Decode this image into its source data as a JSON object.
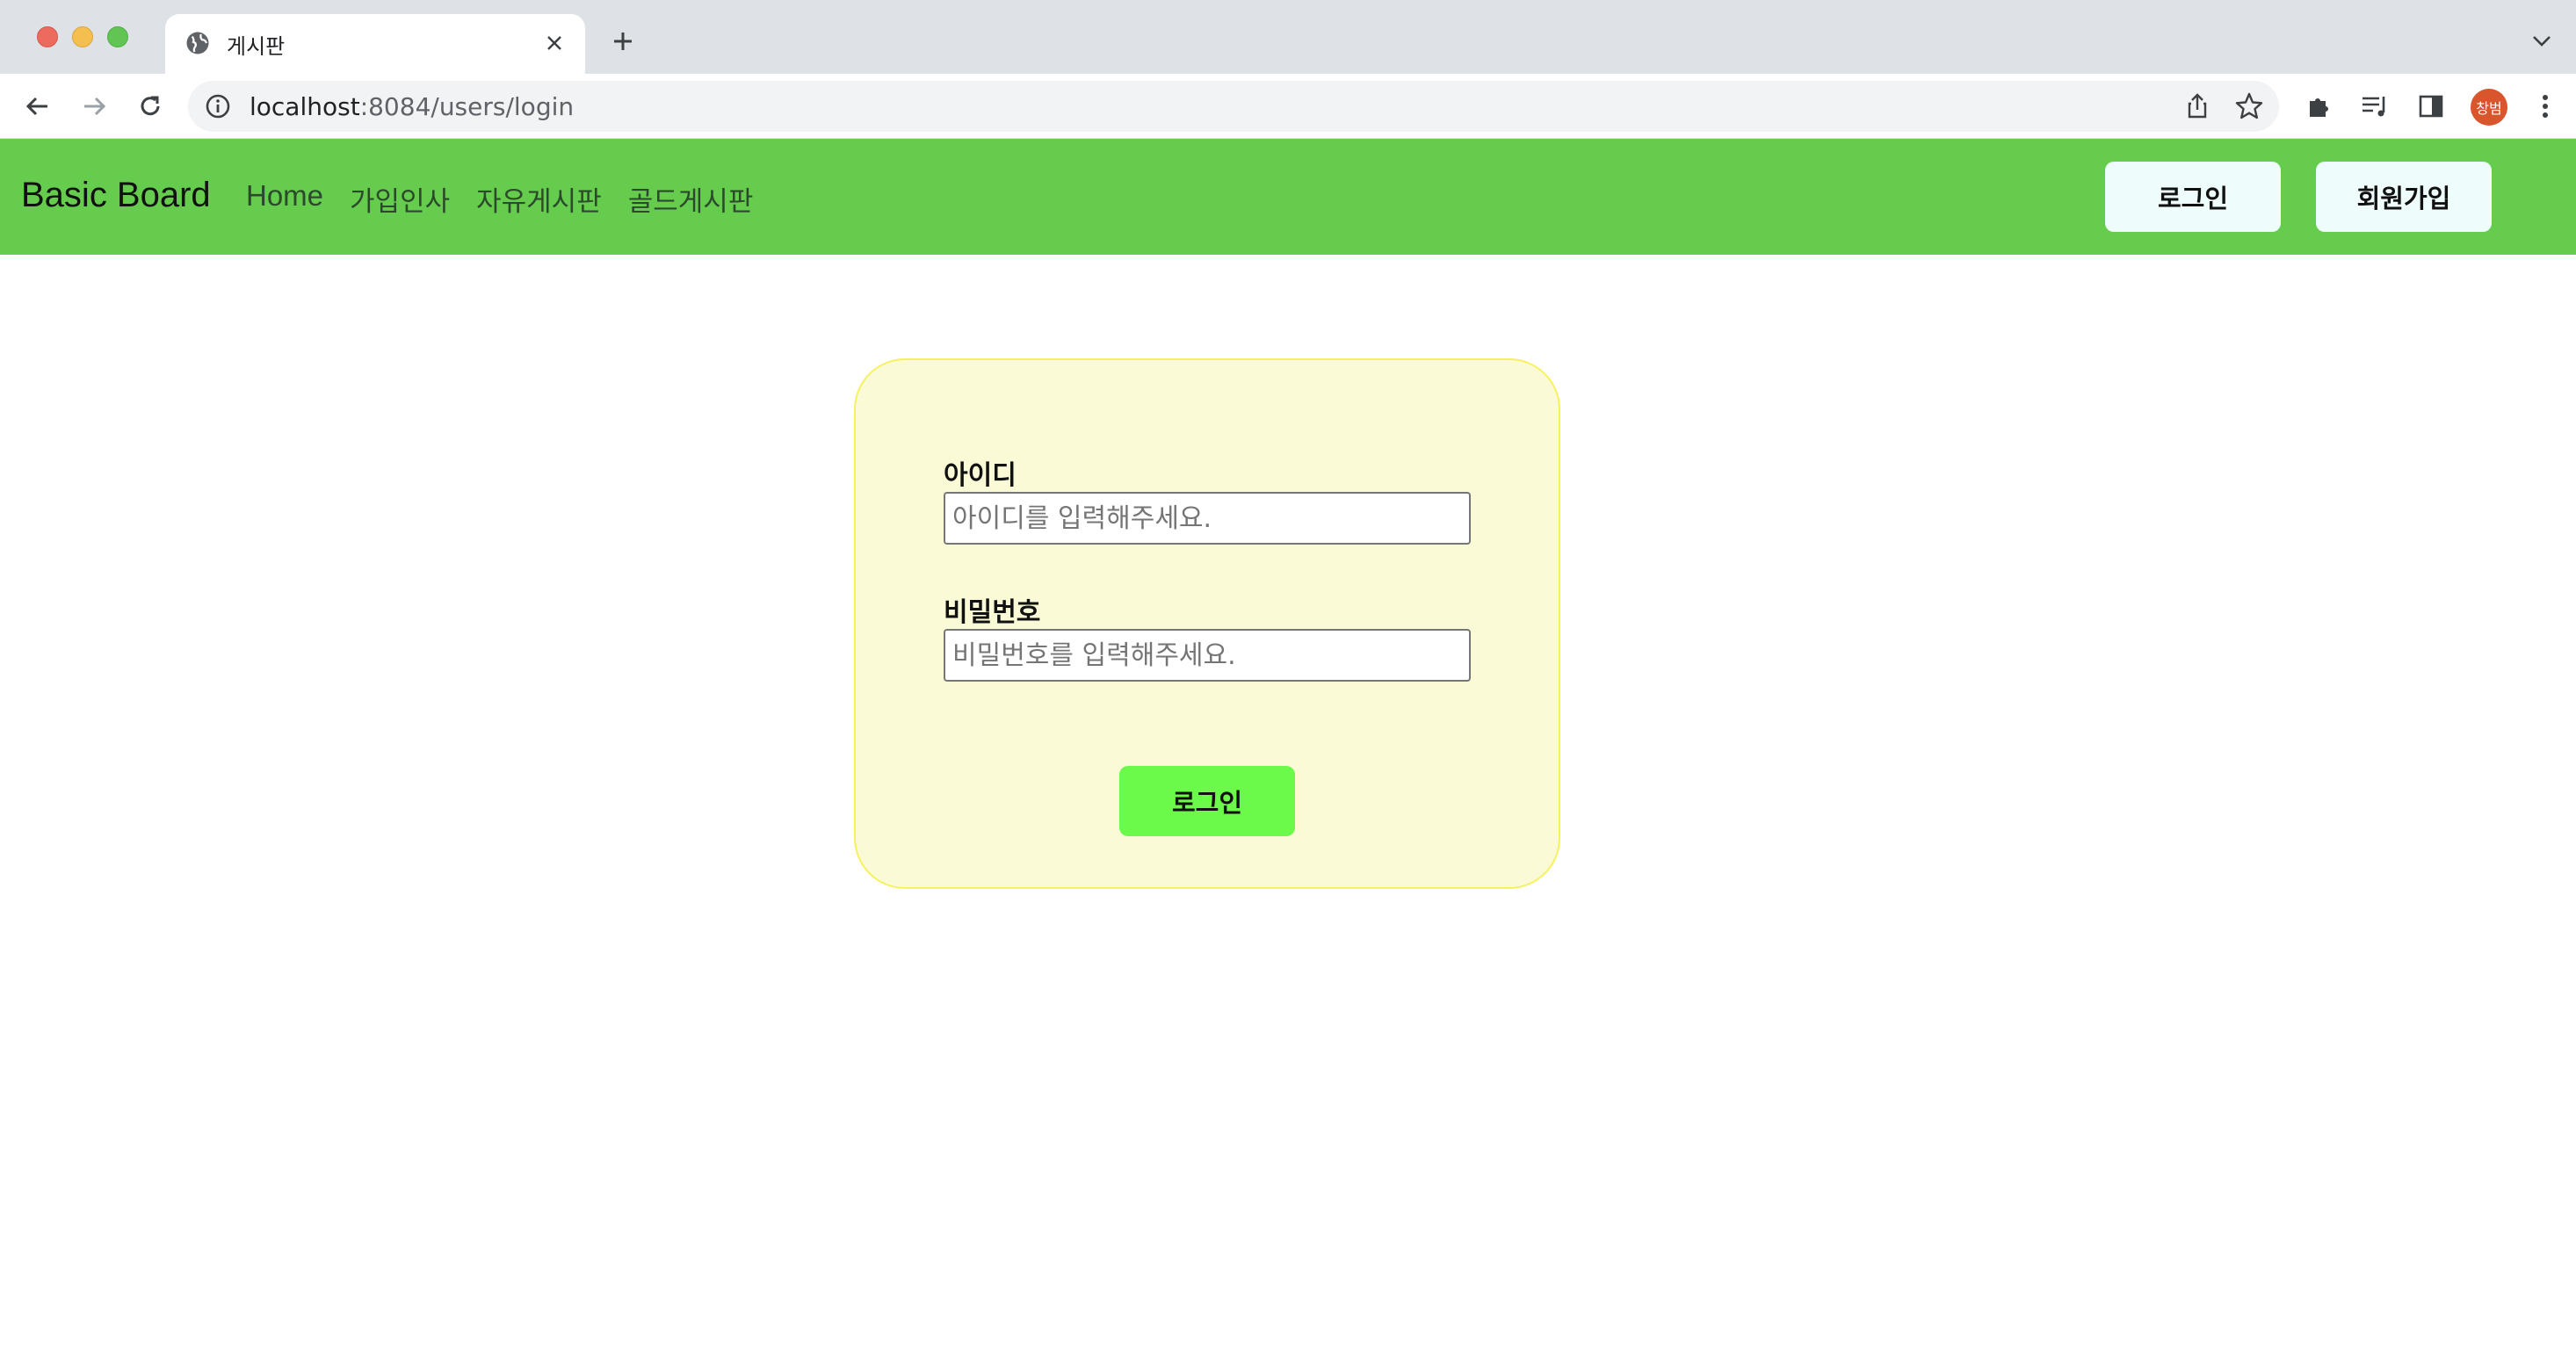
{
  "browser": {
    "tab_title": "게시판",
    "url_host": "localhost",
    "url_rest": ":8084/users/login",
    "profile_initials": "창범"
  },
  "navbar": {
    "brand": "Basic Board",
    "links": [
      "Home",
      "가입인사",
      "자유게시판",
      "골드게시판"
    ],
    "login_button": "로그인",
    "signup_button": "회원가입",
    "bg_color": "#66cc4d"
  },
  "login_form": {
    "id_label": "아이디",
    "id_placeholder": "아이디를 입력해주세요.",
    "password_label": "비밀번호",
    "password_placeholder": "비밀번호를 입력해주세요.",
    "submit_label": "로그인",
    "card_color": "#fafad7",
    "submit_color": "#6cfa4a"
  }
}
